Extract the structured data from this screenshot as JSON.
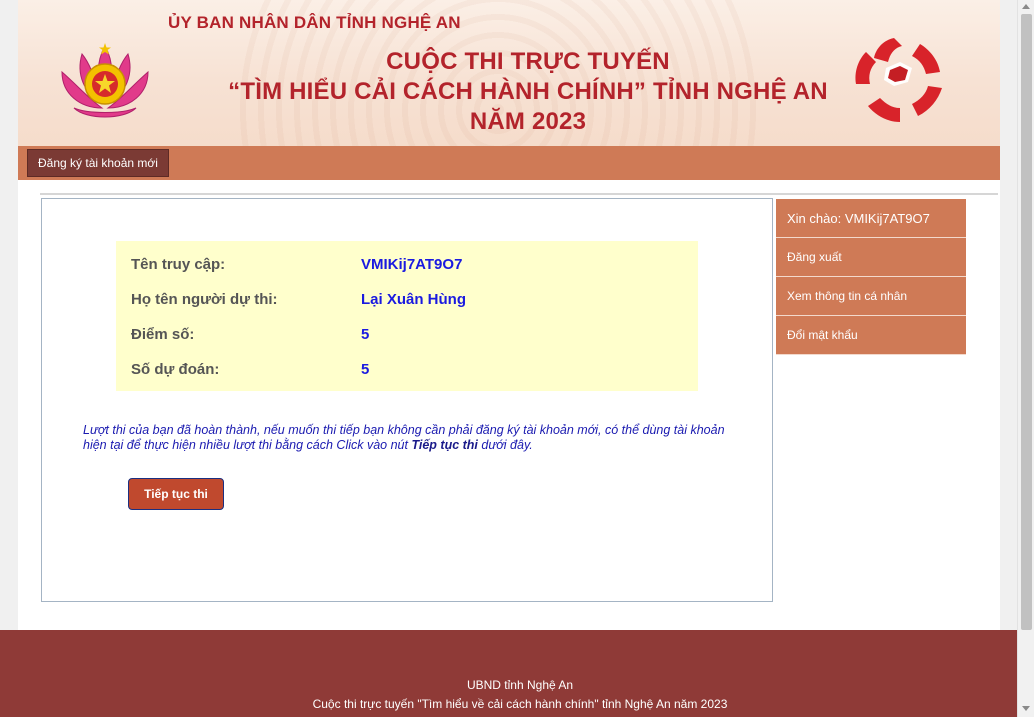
{
  "header": {
    "org": "ỦY BAN NHÂN DÂN TỈNH NGHỆ AN",
    "title_line1": "CUỘC THI TRỰC TUYẾN",
    "title_line2": "“TÌM HIỂU CẢI CÁCH HÀNH CHÍNH” TỈNH NGHỆ AN",
    "title_line3": "NĂM 2023",
    "brand_color": "#b3232b"
  },
  "nav": {
    "register_label": "Đăng ký tài khoản mới"
  },
  "info": {
    "rows": [
      {
        "label": "Tên truy cập:",
        "value": "VMIKij7AT9O7"
      },
      {
        "label": "Họ tên người dự thi:",
        "value": "Lại Xuân Hùng"
      },
      {
        "label": "Điểm số:",
        "value": "5"
      },
      {
        "label": "Số dự đoán:",
        "value": "5"
      }
    ]
  },
  "note": {
    "text_before": "Lượt thi của bạn đã hoàn thành, nếu muốn thi tiếp bạn không cần phải đăng ký tài khoản mới, có thể dùng tài khoản hiện tại để thực hiện nhiều lượt thi bằng cách Click vào nút ",
    "highlight": "Tiếp tục thi",
    "text_after": " dưới đây."
  },
  "continue_label": "Tiếp tục thi",
  "sidebar": {
    "items": [
      {
        "label": "Xin chào: VMIKij7AT9O7"
      },
      {
        "label": "Đăng xuất"
      },
      {
        "label": "Xem thông tin cá nhân"
      },
      {
        "label": "Đổi mật khẩu"
      }
    ]
  },
  "footer": {
    "line1": "UBND tỉnh Nghệ An",
    "line2": "Cuộc thi trực tuyến \"Tìm hiểu về cải cách hành chính\" tỉnh Nghệ An năm 2023"
  },
  "icons": {
    "left_emblem": "lotus-emblem-icon",
    "right_logo": "admin-reform-star-logo-icon"
  }
}
